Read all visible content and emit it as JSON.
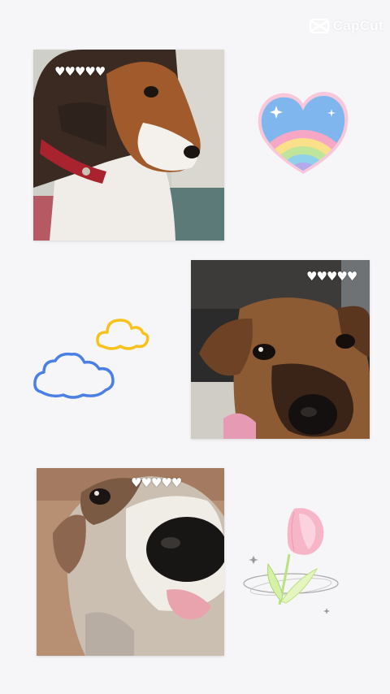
{
  "watermark": {
    "text": "CapCut"
  },
  "photos": [
    {
      "hearts": "♥♥♥♥♥"
    },
    {
      "hearts": "♥♥♥♥♥"
    },
    {
      "hearts": "♥♥♥♥♥"
    }
  ],
  "stickers": {
    "heart": "rainbow-heart-icon",
    "clouds": "clouds-icon",
    "tulip": "tulip-icon"
  },
  "colors": {
    "background": "#f6f6f8",
    "cloud_yellow": "#f7c21c",
    "cloud_blue": "#4a7fe6",
    "heart_outline": "#f5b8d0",
    "tulip_pink": "#f7b6c8"
  }
}
